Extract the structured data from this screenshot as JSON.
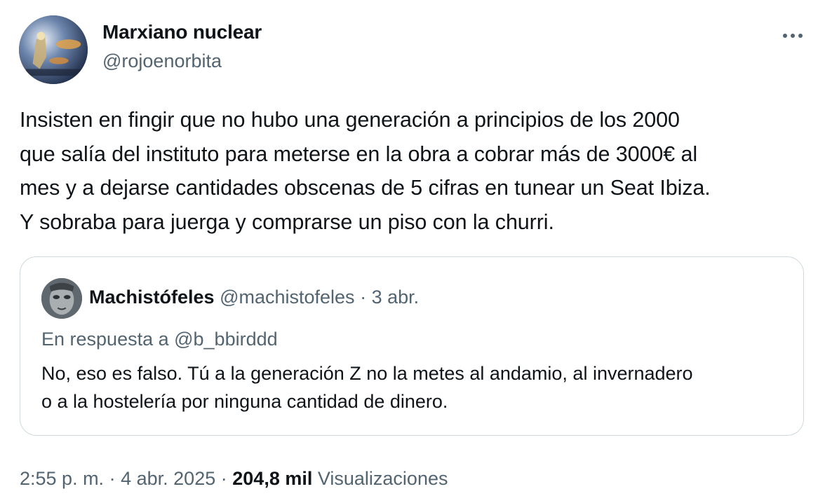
{
  "author": {
    "display_name": "Marxiano nuclear",
    "handle": "@rojoenorbita",
    "avatar_icon": "space-art-avatar"
  },
  "more_icon": "more-horizontal-icon",
  "tweet": {
    "lines": [
      "Insisten en fingir que no hubo una generación a principios de los 2000",
      "que salía del instituto para meterse en la obra a cobrar más de 3000€ al",
      "mes y a dejarse cantidades obscenas de 5 cifras en tunear un Seat Ibiza.",
      "Y sobraba para juerga y comprarse un piso con la churri."
    ]
  },
  "quote": {
    "display_name": "Machistófeles",
    "handle": "@machistofeles",
    "separator": "·",
    "date": "3 abr.",
    "reply_to": "En respuesta a @b_bbirddd",
    "lines": [
      "No, eso es falso. Tú a la generación Z no la metes al andamio, al invernadero",
      "o a la hostelería por ninguna cantidad de dinero."
    ],
    "avatar_icon": "face-avatar"
  },
  "meta": {
    "time": "2:55 p. m.",
    "sep1": "·",
    "date": "4 abr. 2025",
    "sep2": "·",
    "views_count": "204,8 mil",
    "views_label": "Visualizaciones"
  },
  "colors": {
    "text_primary": "#0f1419",
    "text_secondary": "#536471",
    "border": "#cfd9de"
  }
}
